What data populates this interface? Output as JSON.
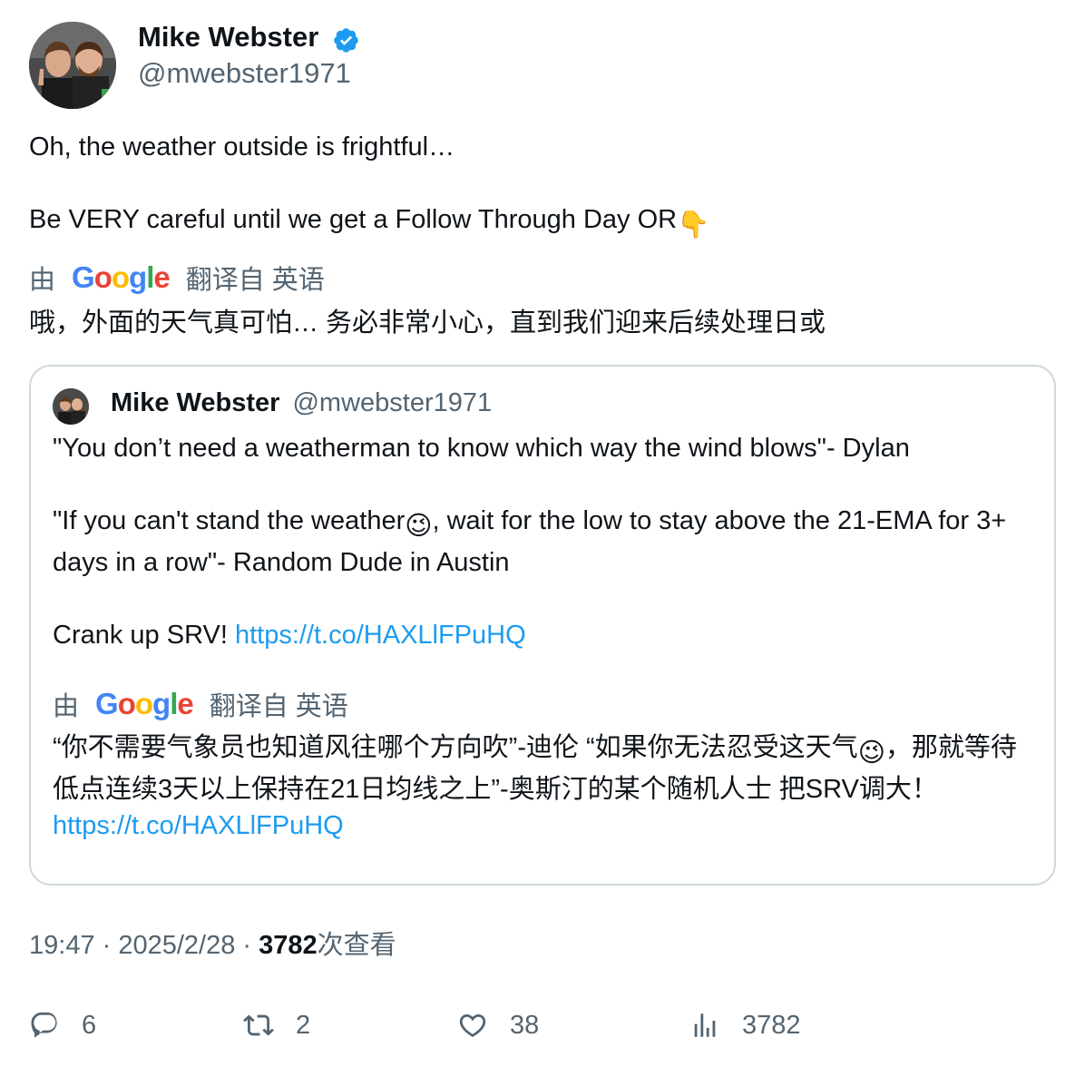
{
  "author": {
    "name": "Mike Webster",
    "handle": "@mwebster1971",
    "verified": true
  },
  "tweet": {
    "line1": "Oh, the weather outside is frightful…",
    "line2": "Be VERY careful until we get a Follow Through Day OR",
    "line2_emoji": "👇"
  },
  "translation_bar": {
    "prefix": "由",
    "provider": "Google",
    "suffix": "翻译自 英语"
  },
  "translation": "哦，外面的天气真可怕… 务必非常小心，直到我们迎来后续处理日或",
  "quoted": {
    "name": "Mike Webster",
    "handle": "@mwebster1971",
    "para1": "\"You don’t need a weatherman to know which way the wind blows\"- Dylan",
    "para2_a": "\"If you can't stand the weather",
    "para2_emoji": "😉",
    "para2_b": ", wait for the low to stay above the 21-EMA for 3+ days in a row\"- Random Dude in Austin",
    "para3_text": "Crank up SRV! ",
    "para3_link": "https://t.co/HAXLlFPuHQ",
    "translation_bar": {
      "prefix": "由",
      "provider": "Google",
      "suffix": "翻译自 英语"
    },
    "translation_a": "“你不需要气象员也知道风往哪个方向吹”-迪伦 “如果你无法忍受这天气",
    "translation_emoji": "😉",
    "translation_b": "，那就等待低点连续3天以上保持在21日均线之上”-奥斯汀的某个随机人士 把SRV调大！ ",
    "translation_link": "https://t.co/HAXLlFPuHQ"
  },
  "meta": {
    "time": "19:47",
    "sep1": " · ",
    "date": "2025/2/28",
    "sep2": " · ",
    "views": "3782",
    "views_label": "次查看"
  },
  "actions": {
    "replies": "6",
    "retweets": "2",
    "likes": "38",
    "views": "3782"
  },
  "colors": {
    "link": "#1d9bf0",
    "secondary": "#536471",
    "verified": "#1d9bf0",
    "border": "#cfd9de"
  }
}
